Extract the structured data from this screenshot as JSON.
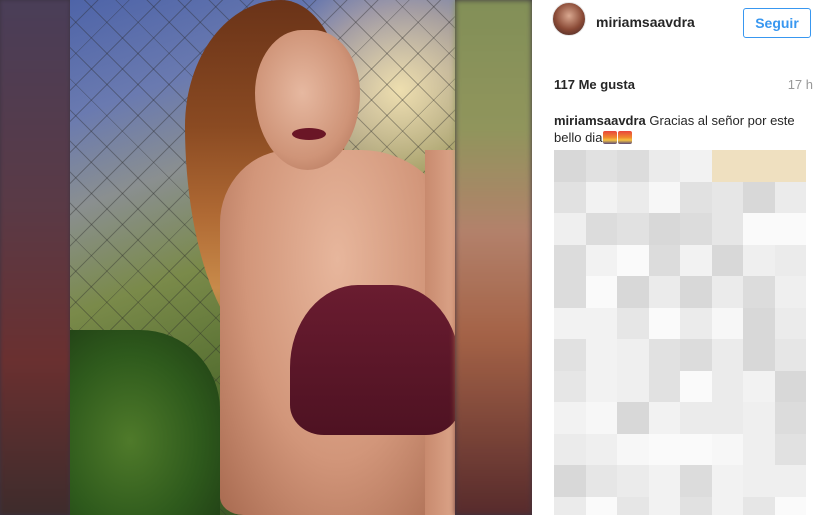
{
  "post": {
    "image_alt_icon": "photo-woman-portrait",
    "author": {
      "username": "miriamsaavdra",
      "avatar_icon": "avatar-photo"
    },
    "follow_label": "Seguir",
    "likes_text": "117 Me gusta",
    "time_text": "17 h",
    "caption": {
      "username": "miriamsaavdra",
      "text": "Gracias al señor por este bello dia",
      "emojis": [
        "sunset-emoji",
        "sunset-emoji"
      ]
    }
  },
  "colors": {
    "accent": "#3897f0",
    "text_primary": "#262626",
    "text_secondary": "#999999"
  }
}
